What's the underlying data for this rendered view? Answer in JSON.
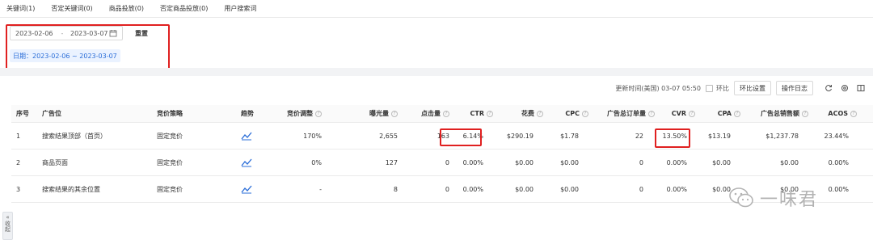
{
  "tabs": [
    {
      "label": "关键词(1)"
    },
    {
      "label": "否定关键词(0)"
    },
    {
      "label": "商品投放(0)"
    },
    {
      "label": "否定商品投放(0)"
    },
    {
      "label": "用户搜索词"
    }
  ],
  "filter": {
    "start_date": "2023-02-06",
    "separator": "-",
    "end_date": "2023-03-07",
    "reset_label": "重置",
    "date_tag": "日期：2023-02-06 ~ 2023-03-07"
  },
  "toolbar": {
    "update_time": "更新时间(美国) 03-07 05:50",
    "compare_label": "环比",
    "compare_settings_label": "环比设置",
    "operation_log_label": "操作日志"
  },
  "table": {
    "columns": [
      "序号",
      "广告位",
      "竞价策略",
      "趋势",
      "竞价调整",
      "曝光量",
      "点击量",
      "CTR",
      "花费",
      "CPC",
      "广告总订单量",
      "CVR",
      "CPA",
      "广告总销售额",
      "ACOS"
    ],
    "rows": [
      {
        "index": "1",
        "placement": "搜索结果顶部（首页）",
        "strategy": "固定竞价",
        "bid_adj": "170%",
        "impressions": "2,655",
        "clicks": "163",
        "ctr": "6.14%",
        "spend": "$290.19",
        "cpc": "$1.78",
        "orders": "22",
        "cvr": "13.50%",
        "cpa": "$13.19",
        "sales": "$1,237.78",
        "acos": "23.44%"
      },
      {
        "index": "2",
        "placement": "商品页面",
        "strategy": "固定竞价",
        "bid_adj": "0%",
        "impressions": "127",
        "clicks": "0",
        "ctr": "0.00%",
        "spend": "$0.00",
        "cpc": "$0.00",
        "orders": "0",
        "cvr": "0.00%",
        "cpa": "$0.00",
        "sales": "$0.00",
        "acos": "0.00%"
      },
      {
        "index": "3",
        "placement": "搜索结果的其余位置",
        "strategy": "固定竞价",
        "bid_adj": "-",
        "impressions": "8",
        "clicks": "0",
        "ctr": "0.00%",
        "spend": "$0.00",
        "cpc": "$0.00",
        "orders": "0",
        "cvr": "0.00%",
        "cpa": "$0.00",
        "sales": "$0.00",
        "acos": "0.00%"
      }
    ]
  },
  "sidebar": {
    "collapse_label": "收起"
  },
  "watermark": {
    "text": "一味君"
  },
  "colors": {
    "accent": "#2a6dd8",
    "highlight": "#e02020",
    "tag_bg": "#eaf2ff"
  }
}
